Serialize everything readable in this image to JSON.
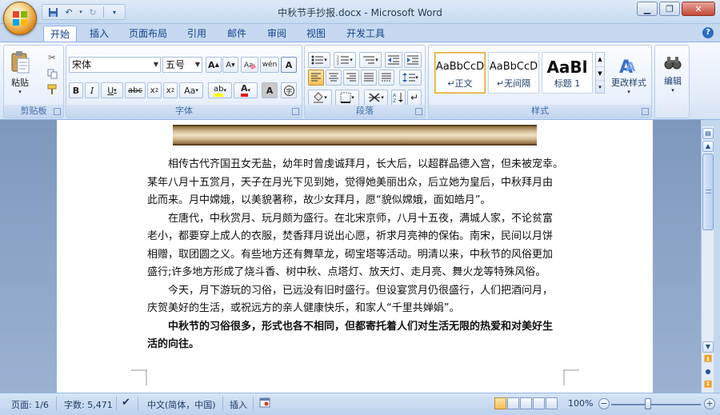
{
  "window": {
    "title": "中秋节手抄报.docx - Microsoft Word"
  },
  "qat": {
    "items": [
      "save-icon",
      "undo-icon",
      "redo-icon",
      "customize-icon"
    ]
  },
  "tabs": [
    {
      "label": "开始",
      "active": true
    },
    {
      "label": "插入"
    },
    {
      "label": "页面布局"
    },
    {
      "label": "引用"
    },
    {
      "label": "邮件"
    },
    {
      "label": "审阅"
    },
    {
      "label": "视图"
    },
    {
      "label": "开发工具"
    }
  ],
  "ribbon": {
    "clipboard": {
      "label": "剪贴板",
      "paste": "粘贴"
    },
    "font": {
      "label": "字体",
      "font_name": "宋体",
      "font_size": "五号"
    },
    "paragraph": {
      "label": "段落"
    },
    "styles": {
      "label": "样式",
      "items": [
        {
          "sample": "AaBbCcD",
          "name": "↵正文",
          "selected": true
        },
        {
          "sample": "AaBbCcD",
          "name": "↵无间隔"
        },
        {
          "sample": "AaBl",
          "name": "标题 1"
        }
      ],
      "change_styles": "更改样式"
    },
    "editing": {
      "label": "编辑"
    }
  },
  "document": {
    "paragraphs": [
      {
        "bold": false,
        "lines": [
          "相传古代齐国丑女无盐，幼年时曾虔诚拜月，长大后，以超群品德入宫，但未被宠幸。",
          "某年八月十五赏月，天子在月光下见到她，觉得她美丽出众，后立她为皇后，中秋拜月由",
          "此而来。月中嫦娥，以美貌著称，故少女拜月，愿“貌似嫦娥，面如皓月”。"
        ]
      },
      {
        "bold": false,
        "lines": [
          "在唐代，中秋赏月、玩月颇为盛行。在北宋京师，八月十五夜，满城人家，不论贫富",
          "老小，都要穿上成人的衣服，焚香拜月说出心愿，祈求月亮神的保佑。南宋，民间以月饼",
          "相赠，取团圆之义。有些地方还有舞草龙，砌宝塔等活动。明清以来，中秋节的风俗更加",
          "盛行;许多地方形成了烧斗香、树中秋、点塔灯、放天灯、走月亮、舞火龙等特殊风俗。"
        ]
      },
      {
        "bold": false,
        "lines": [
          "今天，月下游玩的习俗，已远没有旧时盛行。但设宴赏月仍很盛行，人们把酒问月，",
          "庆贺美好的生活，或祝远方的亲人健康快乐，和家人“千里共婵娟”。"
        ]
      },
      {
        "bold": true,
        "lines": [
          "中秋节的习俗很多，形式也各不相同，但都寄托着人们对生活无限的热爱和对美好生",
          "活的向往。"
        ]
      }
    ]
  },
  "statusbar": {
    "page": "页面: 1/6",
    "words": "字数: 5,471",
    "language": "中文(简体，中国)",
    "mode": "插入",
    "zoom": "100%"
  }
}
